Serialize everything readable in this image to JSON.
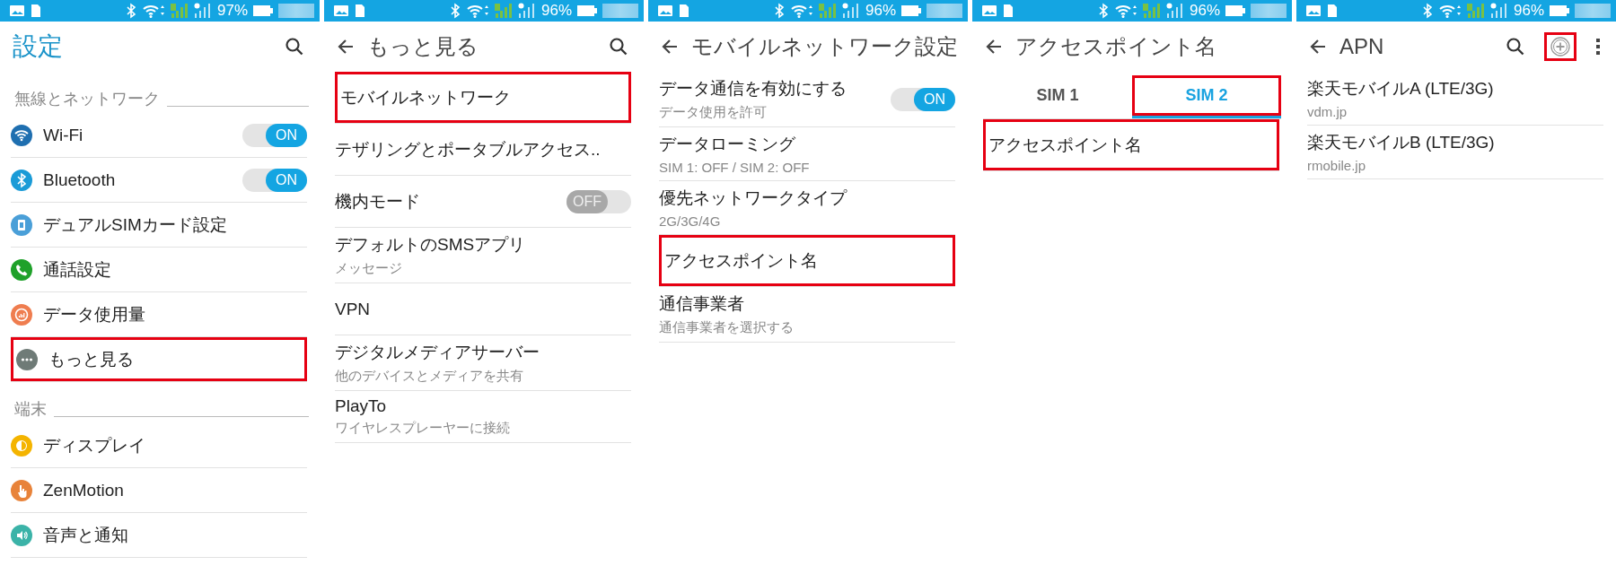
{
  "screens": [
    {
      "status_bar": {
        "battery": "97%"
      },
      "header": {
        "title": "設定",
        "back": false,
        "actions": [
          {
            "kind": "search",
            "highlighted": false
          }
        ]
      },
      "items": [
        {
          "kind": "section",
          "title": "無線とネットワーク"
        },
        {
          "kind": "row",
          "title": "Wi-Fi",
          "color": "#1f6fb0",
          "toggle": {
            "on": true,
            "label": "ON"
          },
          "highlighted": false
        },
        {
          "kind": "row",
          "title": "Bluetooth",
          "color": "#1a9bd7",
          "toggle": {
            "on": true,
            "label": "ON"
          },
          "highlighted": false
        },
        {
          "kind": "row",
          "title": "デュアルSIMカード設定",
          "color": "#4a9fd8",
          "highlighted": false
        },
        {
          "kind": "row",
          "title": "通話設定",
          "color": "#1fa12a",
          "highlighted": false
        },
        {
          "kind": "row",
          "title": "データ使用量",
          "color": "#ef7d4f",
          "highlighted": false
        },
        {
          "kind": "row",
          "title": "もっと見る",
          "color": "#6f7b77",
          "highlighted": true
        },
        {
          "kind": "section",
          "title": "端末"
        },
        {
          "kind": "row",
          "title": "ディスプレイ",
          "color": "#f4b400",
          "highlighted": false
        },
        {
          "kind": "row",
          "title": "ZenMotion",
          "color": "#e8833a",
          "highlighted": false
        },
        {
          "kind": "row",
          "title": "音声と通知",
          "color": "#3bb3a8",
          "highlighted": false
        }
      ]
    },
    {
      "status_bar": {
        "battery": "96%"
      },
      "header": {
        "title": "もっと見る",
        "back": true,
        "actions": [
          {
            "kind": "search",
            "highlighted": false
          }
        ]
      },
      "items": [
        {
          "kind": "row",
          "title": "モバイルネットワーク",
          "highlighted": true
        },
        {
          "kind": "row",
          "title": "テザリングとポータブルアクセス..",
          "highlighted": false
        },
        {
          "kind": "row",
          "title": "機内モード",
          "toggle": {
            "on": false,
            "label": "OFF"
          },
          "highlighted": false
        },
        {
          "kind": "row",
          "title": "デフォルトのSMSアプリ",
          "subtitle": "メッセージ",
          "highlighted": false
        },
        {
          "kind": "row",
          "title": "VPN",
          "highlighted": false
        },
        {
          "kind": "row",
          "title": "デジタルメディアサーバー",
          "subtitle": "他のデバイスとメディアを共有",
          "highlighted": false
        },
        {
          "kind": "row",
          "title": "PlayTo",
          "subtitle": "ワイヤレスプレーヤーに接続",
          "highlighted": false
        }
      ]
    },
    {
      "status_bar": {
        "battery": "96%"
      },
      "header": {
        "title": "モバイルネットワーク設定",
        "back": true
      },
      "items": [
        {
          "kind": "row",
          "title": "データ通信を有効にする",
          "subtitle": "データ使用を許可",
          "toggle": {
            "on": true,
            "label": "ON"
          },
          "highlighted": false
        },
        {
          "kind": "row",
          "title": "データローミング",
          "subtitle": "SIM 1: OFF / SIM 2: OFF",
          "highlighted": false
        },
        {
          "kind": "row",
          "title": "優先ネットワークタイプ",
          "subtitle": "2G/3G/4G",
          "highlighted": false
        },
        {
          "kind": "row",
          "title": "アクセスポイント名",
          "highlighted": true
        },
        {
          "kind": "row",
          "title": "通信事業者",
          "subtitle": "通信事業者を選択する",
          "highlighted": false
        }
      ]
    },
    {
      "status_bar": {
        "battery": "96%"
      },
      "header": {
        "title": "アクセスポイント名",
        "back": true
      },
      "tabs": [
        {
          "label": "SIM 1",
          "selected": false,
          "highlighted": false
        },
        {
          "label": "SIM 2",
          "selected": true,
          "highlighted": true
        }
      ],
      "items": [
        {
          "kind": "row",
          "title": "アクセスポイント名",
          "highlighted": true
        }
      ]
    },
    {
      "status_bar": {
        "battery": "96%"
      },
      "header": {
        "title": "APN",
        "back": true,
        "actions": [
          {
            "kind": "search",
            "highlighted": false
          },
          {
            "kind": "add",
            "highlighted": true
          },
          {
            "kind": "more",
            "highlighted": false
          }
        ]
      },
      "items": [
        {
          "kind": "row",
          "title": "楽天モバイルA (LTE/3G)",
          "subtitle": "vdm.jp",
          "highlighted": false
        },
        {
          "kind": "row",
          "title": "楽天モバイルB (LTE/3G)",
          "subtitle": "rmobile.jp",
          "highlighted": false
        }
      ]
    }
  ]
}
